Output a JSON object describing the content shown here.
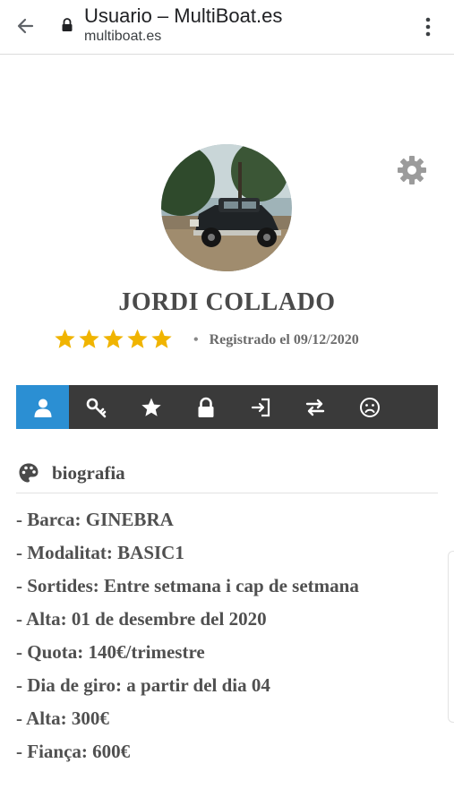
{
  "browser": {
    "title": "Usuario – MultiBoat.es",
    "url": "multiboat.es"
  },
  "profile": {
    "name": "JORDI COLLADO",
    "rating": 5,
    "rating_max": 5,
    "registered": "Registrado el 09/12/2020"
  },
  "tabs": [
    {
      "icon": "user-icon",
      "active": true
    },
    {
      "icon": "key-icon",
      "active": false
    },
    {
      "icon": "star-icon",
      "active": false
    },
    {
      "icon": "lock-icon",
      "active": false
    },
    {
      "icon": "sign-in-icon",
      "active": false
    },
    {
      "icon": "exchange-icon",
      "active": false
    },
    {
      "icon": "frown-icon",
      "active": false
    }
  ],
  "section": {
    "title": "biografia",
    "icon": "palette-icon"
  },
  "bio_lines": [
    "- Barca: GINEBRA",
    "- Modalitat: BASIC1",
    "- Sortides: Entre setmana i cap de setmana",
    "- Alta: 01 de desembre del 2020",
    "- Quota: 140€/trimestre",
    "- Dia de giro: a partir del dia 04",
    "- Alta: 300€",
    "- Fiança: 600€"
  ],
  "colors": {
    "accent": "#2b8fd3",
    "tabbar": "#3a3a3a",
    "star": "#f0b400"
  }
}
